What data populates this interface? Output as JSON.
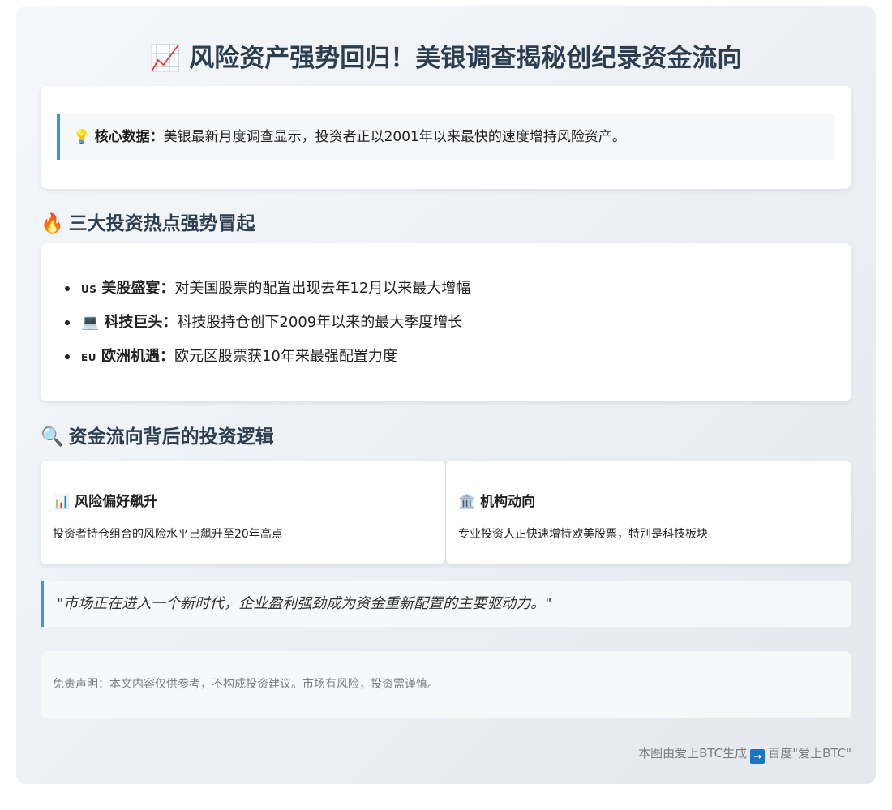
{
  "header": {
    "title_icon": "chart-increasing-icon",
    "title_emoji": "📈",
    "title": "风险资产强势回归！美银调查揭秘创纪录资金流向"
  },
  "core": {
    "icon": "lightbulb-icon",
    "emoji": "💡",
    "label": "核心数据：",
    "text": "美银最新月度调查显示，投资者正以2001年以来最快的速度增持风险资产。"
  },
  "hotspots": {
    "icon": "fire-icon",
    "emoji": "🔥",
    "heading": "三大投资热点强势冒起",
    "items": [
      {
        "flag": "US",
        "label": "美股盛宴：",
        "text": "对美国股票的配置出现去年12月以来最大增幅"
      },
      {
        "emoji": "💻",
        "label": "科技巨头：",
        "text": "科技股持仓创下2009年以来的最大季度增长"
      },
      {
        "flag": "EU",
        "label": "欧洲机遇：",
        "text": "欧元区股票获10年来最强配置力度"
      }
    ]
  },
  "logic": {
    "icon": "magnifier-icon",
    "emoji": "🔍",
    "heading": "资金流向背后的投资逻辑",
    "cards": [
      {
        "emoji": "📊",
        "title": "风险偏好飙升",
        "text": "投资者持仓组合的风险水平已飙升至20年高点"
      },
      {
        "emoji": "🏛️",
        "title": "机构动向",
        "text": "专业投资人正快速增持欧美股票，特别是科技板块"
      }
    ]
  },
  "quote": "\"市场正在进入一个新时代，企业盈利强劲成为资金重新配置的主要驱动力。\"",
  "disclaimer": "免责声明：本文内容仅供参考，不构成投资建议。市场有风险，投资需谨慎。",
  "footer": {
    "left": "本图由爱上BTC生成",
    "arrow": "→",
    "right": "百度\"爱上BTC\""
  }
}
